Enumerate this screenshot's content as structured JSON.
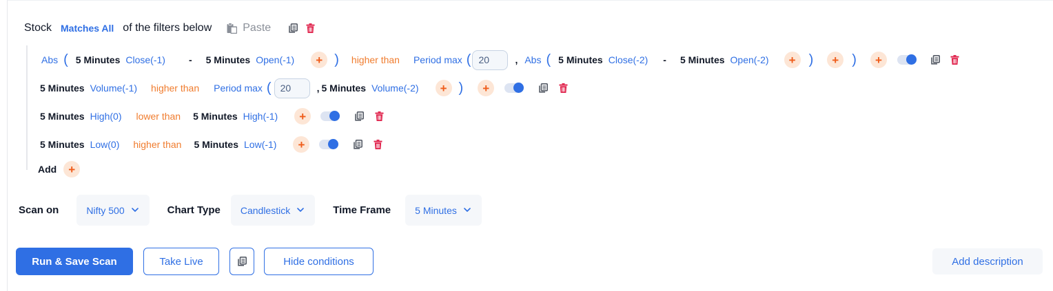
{
  "header": {
    "stock": "Stock",
    "matches": "Matches All",
    "rest": "of the filters below",
    "paste": "Paste"
  },
  "conditions": {
    "row1": {
      "abs1": "Abs",
      "tf1": "5 Minutes",
      "f1": "Close(-1)",
      "op1": "-",
      "tf2": "5 Minutes",
      "f2": "Open(-1)",
      "cmp": "higher than",
      "pmax": "Period max",
      "val": "20",
      "comma": ",",
      "abs2": "Abs",
      "tf3": "5 Minutes",
      "f3": "Close(-2)",
      "op2": "-",
      "tf4": "5 Minutes",
      "f4": "Open(-2)"
    },
    "row2": {
      "tf1": "5 Minutes",
      "f1": "Volume(-1)",
      "cmp": "higher than",
      "pmax": "Period max",
      "val": "20",
      "comma": ",",
      "tf2": "5 Minutes",
      "f2": "Volume(-2)"
    },
    "row3": {
      "tf1": "5 Minutes",
      "f1": "High(0)",
      "cmp": "lower than",
      "tf2": "5 Minutes",
      "f2": "High(-1)"
    },
    "row4": {
      "tf1": "5 Minutes",
      "f1": "Low(0)",
      "cmp": "higher than",
      "tf2": "5 Minutes",
      "f2": "Low(-1)"
    },
    "add_label": "Add",
    "plus": "+",
    "paren_open": "(",
    "paren_close": ")"
  },
  "settings": {
    "scan_on_label": "Scan on",
    "scan_on_value": "Nifty 500",
    "chart_type_label": "Chart Type",
    "chart_type_value": "Candlestick",
    "time_frame_label": "Time Frame",
    "time_frame_value": "5 Minutes"
  },
  "actions": {
    "run_save": "Run & Save Scan",
    "take_live": "Take Live",
    "hide_conditions": "Hide conditions",
    "add_description": "Add description"
  },
  "colors": {
    "accent": "#2f6fe4",
    "operator": "#f07c2e",
    "delete": "#e0244d"
  }
}
